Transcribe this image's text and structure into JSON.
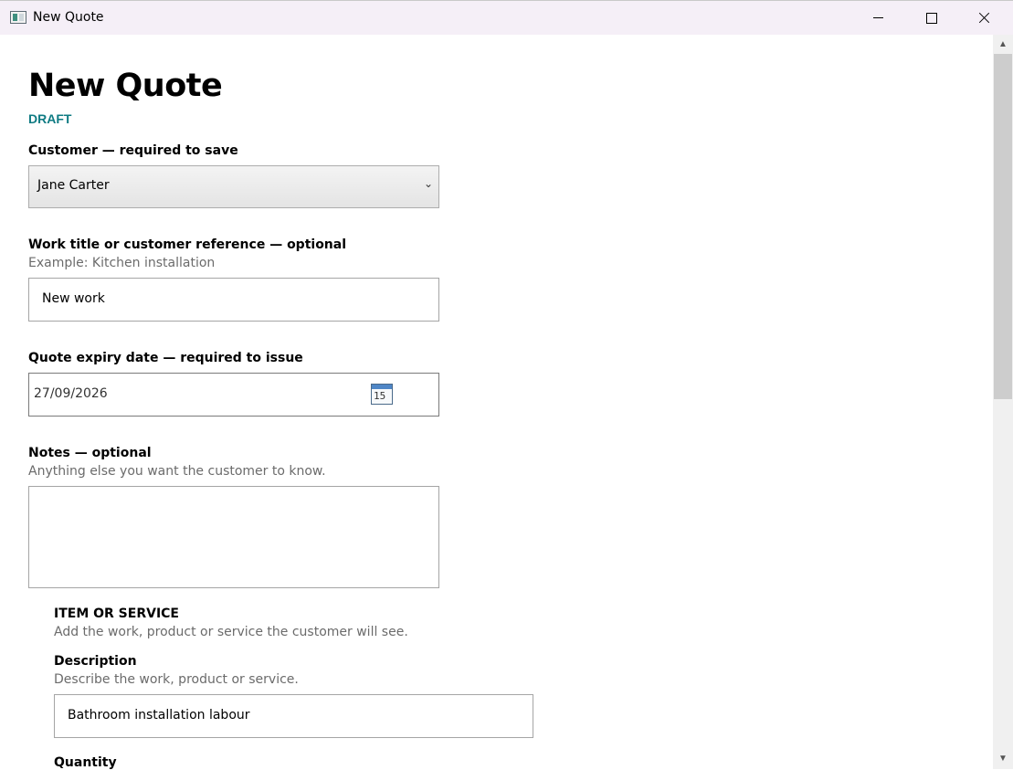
{
  "window": {
    "title": "New Quote",
    "icon": "app-window-icon",
    "controls": [
      "minimize-icon",
      "maximize-icon",
      "close-icon"
    ]
  },
  "page": {
    "title": "New Quote",
    "status": "DRAFT",
    "status_color": "#0f7b83"
  },
  "customer": {
    "label": "Customer — required to save",
    "value": "Jane Carter",
    "chevron": "⌄"
  },
  "work_title": {
    "label": "Work title or customer reference — optional",
    "hint": "Example: Kitchen installation",
    "value": "New work"
  },
  "expiry": {
    "label": "Quote expiry date — required to issue",
    "value": "27/09/2026",
    "calendar_day": "15"
  },
  "notes": {
    "label": "Notes — optional",
    "hint": "Anything else you want the customer to know.",
    "value": ""
  },
  "item": {
    "section_title": "ITEM OR SERVICE",
    "section_hint": "Add the work, product or service the customer will see.",
    "description_label": "Description",
    "description_hint": "Describe the work, product or service.",
    "description_value": "Bathroom installation labour",
    "quantity_label": "Quantity"
  },
  "scrollbar": {
    "up_arrow": "▲",
    "down_arrow": "▼"
  }
}
